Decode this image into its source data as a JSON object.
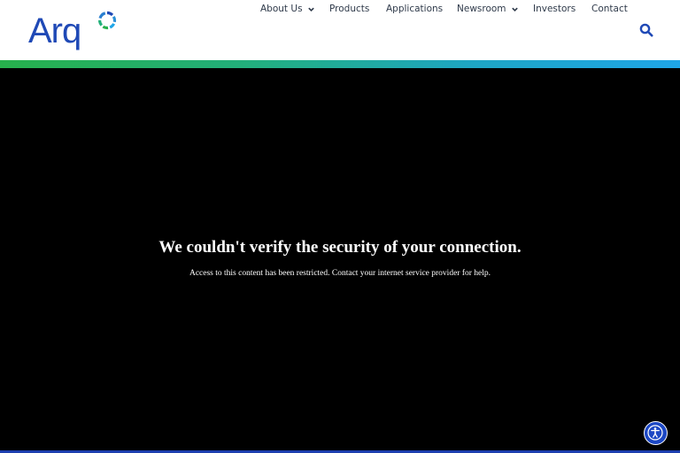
{
  "header": {
    "logo_text": "Arq",
    "nav": [
      {
        "label": "About Us",
        "has_dropdown": true
      },
      {
        "label": "Products",
        "has_dropdown": false
      },
      {
        "label": "Applications",
        "has_dropdown": false
      },
      {
        "label": "Newsroom",
        "has_dropdown": true
      },
      {
        "label": "Investors",
        "has_dropdown": false
      },
      {
        "label": "Contact",
        "has_dropdown": false
      }
    ],
    "search_icon": "search-icon"
  },
  "colors": {
    "brand_blue": "#1f49b6",
    "gradient_start": "#27b14c",
    "gradient_end": "#1fa6e8",
    "page_background": "#000000",
    "a11y_button": "#1c47c4"
  },
  "message": {
    "title": "We couldn't verify the security of your connection.",
    "subtitle": "Access to this content has been restricted. Contact your internet service provider for help."
  },
  "accessibility_button": {
    "icon": "accessibility-icon"
  }
}
